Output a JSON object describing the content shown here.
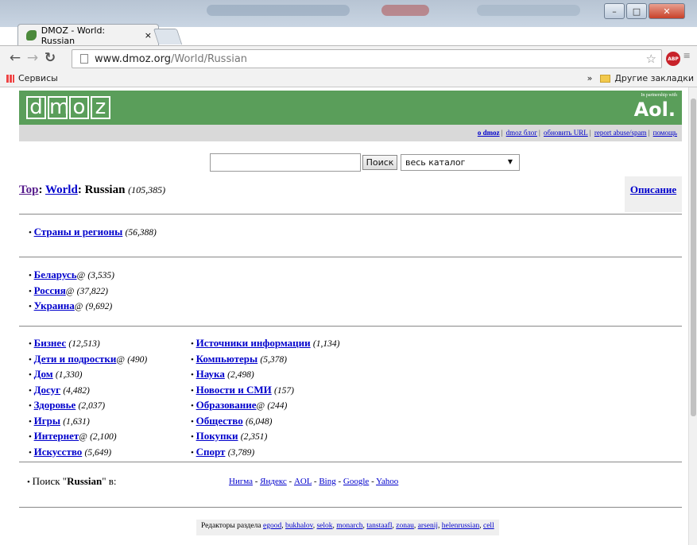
{
  "browser": {
    "tab_title": "DMOZ - World: Russian",
    "tab_close": "×",
    "url_host": "www.dmoz.org",
    "url_path": "/World/Russian",
    "bookmarks_apps": "Сервисы",
    "bookmarks_more": "»",
    "bookmarks_other": "Другие закладки",
    "abp": "ABP",
    "win_min": "–",
    "win_max": "□",
    "win_close": "✕"
  },
  "header": {
    "logo_letters": [
      "d",
      "m",
      "o",
      "z"
    ],
    "aol_small": "In partnership with",
    "aol": "Aol.",
    "links": [
      "о dmoz",
      "dmoz блог",
      "обновить URL",
      "report abuse/spam",
      "помощь"
    ]
  },
  "search": {
    "input_value": "",
    "button": "Поиск",
    "scope": "весь каталог"
  },
  "breadcrumb": {
    "top": "Top",
    "world": "World",
    "current": "Russian",
    "count": "(105,385)"
  },
  "description": "Описание",
  "section1": [
    {
      "label": "Страны и регионы",
      "at": "",
      "count": "(56,388)"
    }
  ],
  "section2": [
    {
      "label": "Беларусь",
      "at": "@",
      "count": "(3,535)"
    },
    {
      "label": "Россия",
      "at": "@",
      "count": "(37,822)"
    },
    {
      "label": "Украина",
      "at": "@",
      "count": "(9,692)"
    }
  ],
  "section3_col1": [
    {
      "label": "Бизнес",
      "at": "",
      "count": "(12,513)"
    },
    {
      "label": "Дети и подростки",
      "at": "@",
      "count": "(490)"
    },
    {
      "label": "Дом",
      "at": "",
      "count": "(1,330)"
    },
    {
      "label": "Досуг",
      "at": "",
      "count": "(4,482)"
    },
    {
      "label": "Здоровье",
      "at": "",
      "count": "(2,037)"
    },
    {
      "label": "Игры",
      "at": "",
      "count": "(1,631)"
    },
    {
      "label": "Интернет",
      "at": "@",
      "count": "(2,100)"
    },
    {
      "label": "Искусство",
      "at": "",
      "count": "(5,649)"
    }
  ],
  "section3_col2": [
    {
      "label": "Источники информации",
      "at": "",
      "count": "(1,134)"
    },
    {
      "label": "Компьютеры",
      "at": "",
      "count": "(5,378)"
    },
    {
      "label": "Наука",
      "at": "",
      "count": "(2,498)"
    },
    {
      "label": "Новости и СМИ",
      "at": "",
      "count": "(157)"
    },
    {
      "label": "Образование",
      "at": "@",
      "count": "(244)"
    },
    {
      "label": "Общество",
      "at": "",
      "count": "(6,048)"
    },
    {
      "label": "Покупки",
      "at": "",
      "count": "(2,351)"
    },
    {
      "label": "Спорт",
      "at": "",
      "count": "(3,789)"
    }
  ],
  "search_in": {
    "prefix": "Поиск \"",
    "term": "Russian",
    "suffix": "\" в:",
    "engines": [
      "Нигма",
      "Яндекс",
      "AOL",
      "Bing",
      "Google",
      "Yahoo"
    ],
    "sep": " - "
  },
  "editors": {
    "prefix": "Редакторы раздела ",
    "names": [
      "egood",
      "bukhalov",
      "selok",
      "monarch",
      "tanstaafl",
      "zonau",
      "arsenij",
      "helenrussian",
      "cell"
    ]
  }
}
